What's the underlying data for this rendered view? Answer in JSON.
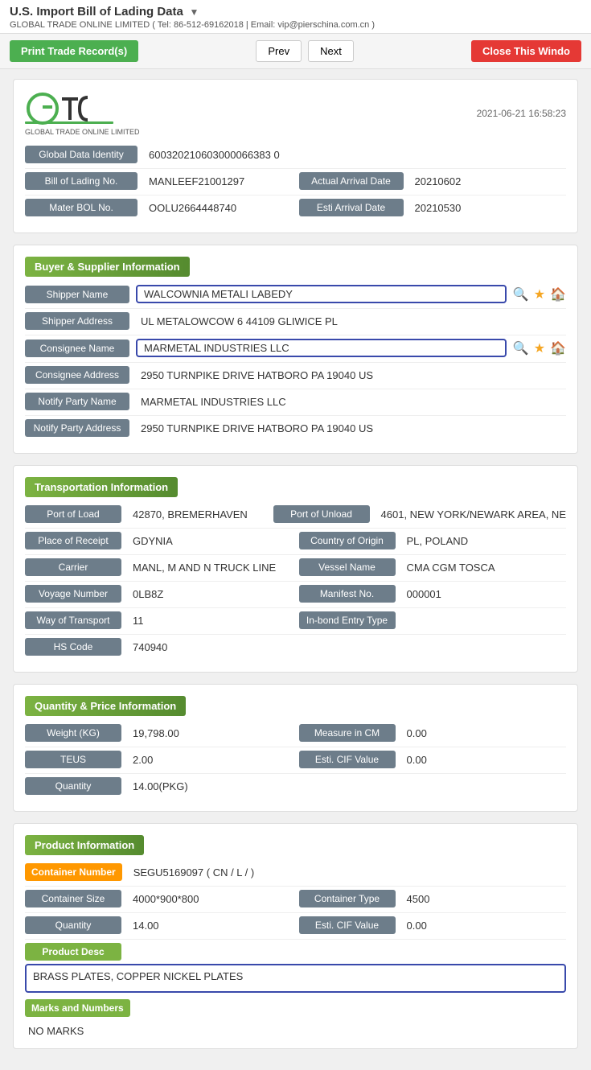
{
  "header": {
    "title": "U.S. Import Bill of Lading Data",
    "arrow": "▼",
    "subtitle": "GLOBAL TRADE ONLINE LIMITED ( Tel: 86-512-69162018 | Email: vip@pierschina.com.cn )"
  },
  "toolbar": {
    "print_label": "Print Trade Record(s)",
    "prev_label": "Prev",
    "next_label": "Next",
    "close_label": "Close This Windo"
  },
  "logo": {
    "company": "GLOBAL TRADE ONLINE LIMITED",
    "timestamp": "2021-06-21 16:58:23"
  },
  "basic_info": {
    "global_data_identity_label": "Global Data Identity",
    "global_data_identity_value": "600320210603000066383 0",
    "bill_of_lading_label": "Bill of Lading No.",
    "bill_of_lading_value": "MANLEEF21001297",
    "actual_arrival_label": "Actual Arrival Date",
    "actual_arrival_value": "20210602",
    "mater_bol_label": "Mater BOL No.",
    "mater_bol_value": "OOLU2664448740",
    "esti_arrival_label": "Esti Arrival Date",
    "esti_arrival_value": "20210530"
  },
  "buyer_supplier": {
    "section_title": "Buyer & Supplier Information",
    "shipper_name_label": "Shipper Name",
    "shipper_name_value": "WALCOWNIA METALI LABEDY",
    "shipper_address_label": "Shipper Address",
    "shipper_address_value": "UL METALOWCOW 6 44109 GLIWICE PL",
    "consignee_name_label": "Consignee Name",
    "consignee_name_value": "MARMETAL INDUSTRIES LLC",
    "consignee_address_label": "Consignee Address",
    "consignee_address_value": "2950 TURNPIKE DRIVE HATBORO PA 19040 US",
    "notify_party_name_label": "Notify Party Name",
    "notify_party_name_value": "MARMETAL INDUSTRIES LLC",
    "notify_party_address_label": "Notify Party Address",
    "notify_party_address_value": "2950 TURNPIKE DRIVE HATBORO PA 19040 US"
  },
  "transportation": {
    "section_title": "Transportation Information",
    "port_of_load_label": "Port of Load",
    "port_of_load_value": "42870, BREMERHAVEN",
    "port_of_unload_label": "Port of Unload",
    "port_of_unload_value": "4601, NEW YORK/NEWARK AREA, NE",
    "place_of_receipt_label": "Place of Receipt",
    "place_of_receipt_value": "GDYNIA",
    "country_of_origin_label": "Country of Origin",
    "country_of_origin_value": "PL, POLAND",
    "carrier_label": "Carrier",
    "carrier_value": "MANL, M AND N TRUCK LINE",
    "vessel_name_label": "Vessel Name",
    "vessel_name_value": "CMA CGM TOSCA",
    "voyage_number_label": "Voyage Number",
    "voyage_number_value": "0LB8Z",
    "manifest_no_label": "Manifest No.",
    "manifest_no_value": "000001",
    "way_of_transport_label": "Way of Transport",
    "way_of_transport_value": "11",
    "inbond_entry_label": "In-bond Entry Type",
    "inbond_entry_value": "",
    "hs_code_label": "HS Code",
    "hs_code_value": "740940"
  },
  "quantity_price": {
    "section_title": "Quantity & Price Information",
    "weight_label": "Weight (KG)",
    "weight_value": "19,798.00",
    "measure_label": "Measure in CM",
    "measure_value": "0.00",
    "teus_label": "TEUS",
    "teus_value": "2.00",
    "esti_cif_label": "Esti. CIF Value",
    "esti_cif_value": "0.00",
    "quantity_label": "Quantity",
    "quantity_value": "14.00(PKG)"
  },
  "product": {
    "section_title": "Product Information",
    "container_number_label": "Container Number",
    "container_number_value": "SEGU5169097 ( CN / L /  )",
    "container_size_label": "Container Size",
    "container_size_value": "4000*900*800",
    "container_type_label": "Container Type",
    "container_type_value": "4500",
    "quantity_label": "Quantity",
    "quantity_value": "14.00",
    "esti_cif_label": "Esti. CIF Value",
    "esti_cif_value": "0.00",
    "product_desc_label": "Product Desc",
    "product_desc_value": "BRASS PLATES, COPPER NICKEL PLATES",
    "marks_label": "Marks and Numbers",
    "marks_value": "NO MARKS"
  }
}
